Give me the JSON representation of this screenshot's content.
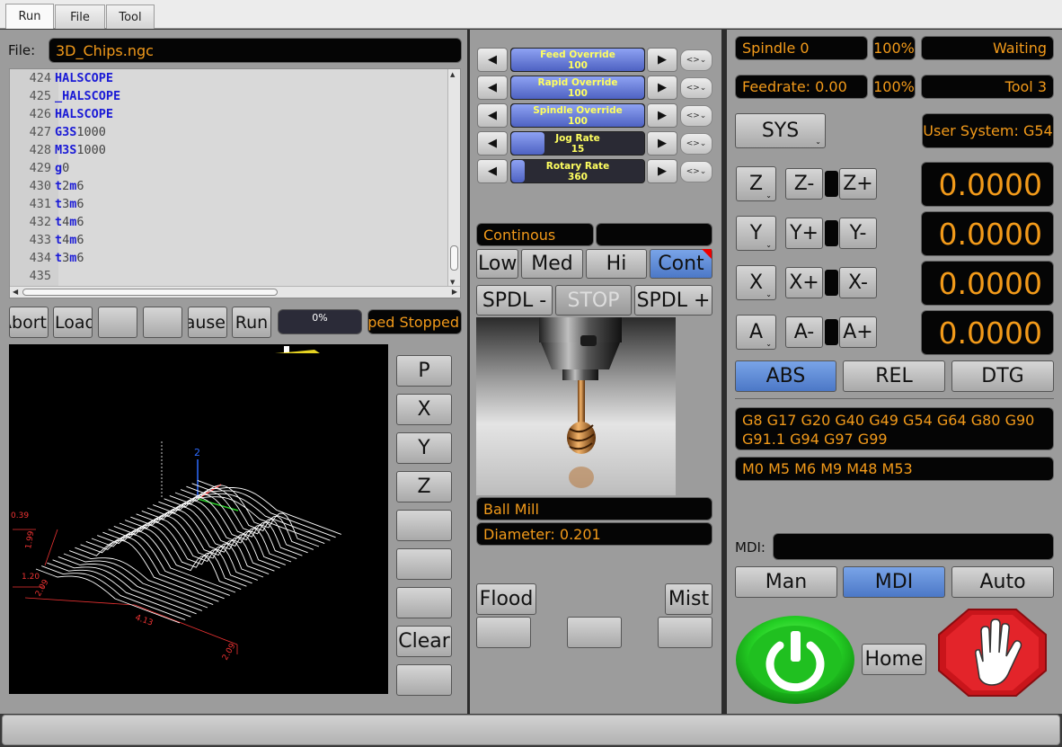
{
  "tabs": [
    "Run",
    "File",
    "Tool"
  ],
  "file": {
    "label": "File:",
    "name": "3D_Chips.ngc",
    "lines": [
      {
        "n": "424",
        "g": "HALSCOPE",
        "r": ""
      },
      {
        "n": "425",
        "g": "_HALSCOPE",
        "r": ""
      },
      {
        "n": "426",
        "g": "HALSCOPE",
        "r": ""
      },
      {
        "n": "427",
        "g": "G3S",
        "r": "1000"
      },
      {
        "n": "428",
        "g": "M3S",
        "r": "1000"
      },
      {
        "n": "429",
        "g": "g",
        "r": "0"
      },
      {
        "n": "430",
        "g": "t",
        "r": "2",
        "g2": "m",
        "r2": "6"
      },
      {
        "n": "431",
        "g": "t",
        "r": "3",
        "g2": "m",
        "r2": "6"
      },
      {
        "n": "432",
        "g": "t",
        "r": "4",
        "g2": "m",
        "r2": "6"
      },
      {
        "n": "433",
        "g": "t",
        "r": "4",
        "g2": "m",
        "r2": "6"
      },
      {
        "n": "434",
        "g": "t",
        "r": "3",
        "g2": "m",
        "r2": "6"
      },
      {
        "n": "435",
        "g": "",
        "r": ""
      }
    ]
  },
  "controls": {
    "abort": "Abort",
    "load": "Load",
    "pause": "Pause",
    "run": "Run",
    "progress_text": "0%",
    "progress": 0,
    "status": "Stopped Stopped"
  },
  "side_buttons": [
    "P",
    "X",
    "Y",
    "Z",
    "",
    "",
    "",
    "Clear",
    ""
  ],
  "backplot": {
    "z_label": "2",
    "dims": [
      "0.39",
      "1.99",
      "1.20",
      "2.09",
      "4.13",
      "2.09"
    ]
  },
  "overrides": [
    {
      "label": "Feed Override",
      "value": "100",
      "fill": 1.0
    },
    {
      "label": "Rapid Override",
      "value": "100",
      "fill": 1.0
    },
    {
      "label": "Spindle Override",
      "value": "100",
      "fill": 1.0
    },
    {
      "label": "Jog Rate",
      "value": "15",
      "fill": 0.25
    },
    {
      "label": "Rotary Rate",
      "value": "360",
      "fill": 0.1
    }
  ],
  "jog": {
    "mode": "Continous",
    "mode_value": "",
    "increments": [
      "Low",
      "Med",
      "Hi",
      "Cont"
    ],
    "spindle_minus": "SPDL -",
    "stop": "STOP",
    "spindle_plus": "SPDL +"
  },
  "tool": {
    "name": "Ball Mill",
    "diameter": "Diameter: 0.201"
  },
  "coolant": {
    "flood": "Flood",
    "mist": "Mist"
  },
  "status": {
    "spindle": "Spindle 0",
    "spindle_pct": "100%",
    "state": "Waiting",
    "feedrate": "Feedrate: 0.00",
    "feed_pct": "100%",
    "tool": "Tool 3",
    "sys_button": "SYS",
    "user_system": "User System: G54"
  },
  "axes": [
    {
      "name": "Z",
      "minus": "Z-",
      "plus": "Z+",
      "value": "0.0000"
    },
    {
      "name": "Y",
      "minus": "Y+",
      "plus": "Y-",
      "value": "0.0000"
    },
    {
      "name": "X",
      "minus": "X+",
      "plus": "X-",
      "value": "0.0000"
    },
    {
      "name": "A",
      "minus": "A-",
      "plus": "A+",
      "value": "0.0000"
    }
  ],
  "coord_modes": [
    "ABS",
    "REL",
    "DTG"
  ],
  "gcodes": "G8 G17 G20 G40 G49 G54 G64 G80 G90 G91.1 G94 G97 G99",
  "mcodes": "M0 M5 M6 M9 M48 M53",
  "mdi": {
    "label": "MDI:",
    "value": ""
  },
  "modes": [
    "Man",
    "MDI",
    "Auto"
  ],
  "home": "Home",
  "colors": {
    "accent_text": "#f29a1a",
    "active_button": "#5f8ad6",
    "power": "#2ed12e",
    "estop": "#d0141a"
  }
}
